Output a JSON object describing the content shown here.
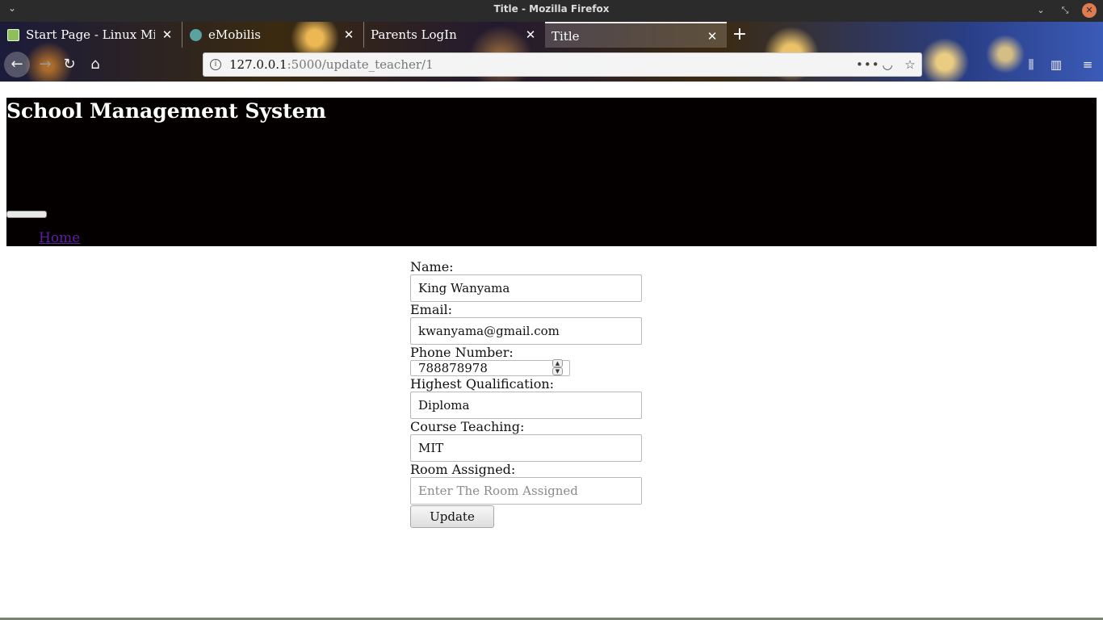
{
  "window": {
    "title": "Title - Mozilla Firefox"
  },
  "tabs": [
    {
      "label": "Start Page - Linux Mi",
      "favicon": "linux-mint-icon",
      "active": false
    },
    {
      "label": "eMobilis",
      "favicon": "globe-icon",
      "active": false
    },
    {
      "label": "Parents LogIn",
      "favicon": "",
      "active": false
    },
    {
      "label": "Title",
      "favicon": "",
      "active": true
    }
  ],
  "navbar": {
    "url_host": "127.0.0.1",
    "url_rest": ":5000/update_teacher/1"
  },
  "site": {
    "title": "School Management System",
    "nav_home": "Home"
  },
  "form": {
    "name_label": "Name:",
    "name_value": "King Wanyama",
    "email_label": "Email:",
    "email_value": "kwanyama@gmail.com",
    "phone_label": "Phone Number:",
    "phone_value": "788878978",
    "qualification_label": "Highest Qualification:",
    "qualification_value": "Diploma",
    "course_label": "Course Teaching:",
    "course_value": "MIT",
    "room_label": "Room Assigned:",
    "room_placeholder": "Enter The Room Assigned",
    "submit_label": "Update"
  },
  "colors": {
    "header_bg": "#050000",
    "link": "#5b1fa3"
  }
}
